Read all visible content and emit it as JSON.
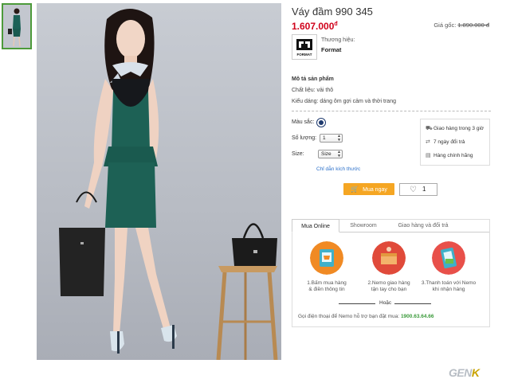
{
  "product": {
    "title": "Váy đầm 990 345",
    "price": "1.607.000",
    "price_currency": "đ",
    "original_price_label": "Giá gốc:",
    "original_price": "1.890.000 đ"
  },
  "brand": {
    "label": "Thương hiệu:",
    "name": "Format",
    "logo_text": "FORMAT"
  },
  "description": {
    "title": "Mô tả sản phẩm",
    "lines": [
      "Chất liệu: vải thô",
      "Kiểu dáng: dáng ôm gợi cảm và thời trang"
    ]
  },
  "options": {
    "color_label": "Màu sắc:",
    "color_value": "#1f3b6f",
    "quantity_label": "Số lượng:",
    "quantity_value": "1",
    "size_label": "Size:",
    "size_value": "Size",
    "size_guide": "Chỉ dẫn kích thước"
  },
  "perks": [
    {
      "icon": "truck-icon",
      "text": "Giao hàng trong 3 giờ"
    },
    {
      "icon": "swap-icon",
      "text": "7 ngày đổi trả"
    },
    {
      "icon": "receipt-icon",
      "text": "Hàng chính hãng"
    }
  ],
  "actions": {
    "buy_label": "Mua ngay",
    "like_count": "1"
  },
  "tabs": [
    {
      "label": "Mua Online",
      "active": true
    },
    {
      "label": "Showroom",
      "active": false
    },
    {
      "label": "Giao hàng và đổi trả",
      "active": false
    }
  ],
  "steps": [
    {
      "line1": "1.Bấm mua hàng",
      "line2": "& điền thông tin"
    },
    {
      "line1": "2.Nemo giao hàng",
      "line2": "tận tay cho bạn"
    },
    {
      "line1": "3.Thanh toán với Nemo",
      "line2": "khi nhận hàng"
    }
  ],
  "or_text": "Hoặc",
  "call": {
    "text": "Gọi điện thoại để Nemo hỗ trợ bạn đặt mua:",
    "phone": "1900.63.64.66"
  },
  "watermark": {
    "main": "GEN",
    "accent": "K"
  },
  "colors": {
    "price": "#d0021b",
    "buy_button": "#f5a623",
    "phone": "#3a9a3a",
    "link": "#2a6fc9",
    "thumb_border": "#4c9a3a"
  }
}
